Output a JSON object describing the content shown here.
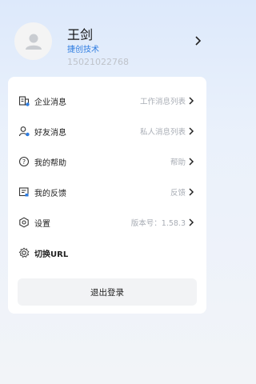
{
  "profile": {
    "name": "王剑",
    "company": "捷创技术",
    "phone": "15021022768"
  },
  "menu": [
    {
      "label": "企业消息",
      "value": "工作消息列表",
      "icon": "building-icon"
    },
    {
      "label": "好友消息",
      "value": "私人消息列表",
      "icon": "person-icon"
    },
    {
      "label": "我的帮助",
      "value": "帮助",
      "icon": "help-circle-icon"
    },
    {
      "label": "我的反馈",
      "value": "反馈",
      "icon": "feedback-icon"
    },
    {
      "label": "设置",
      "value": "版本号：1.58.3",
      "icon": "settings-icon"
    },
    {
      "label": "切换URL",
      "value": "",
      "icon": "switch-icon"
    }
  ],
  "logout_label": "退出登录",
  "colors": {
    "accent": "#2f7de1",
    "card": "#ffffff",
    "muted": "#a8adb5"
  }
}
